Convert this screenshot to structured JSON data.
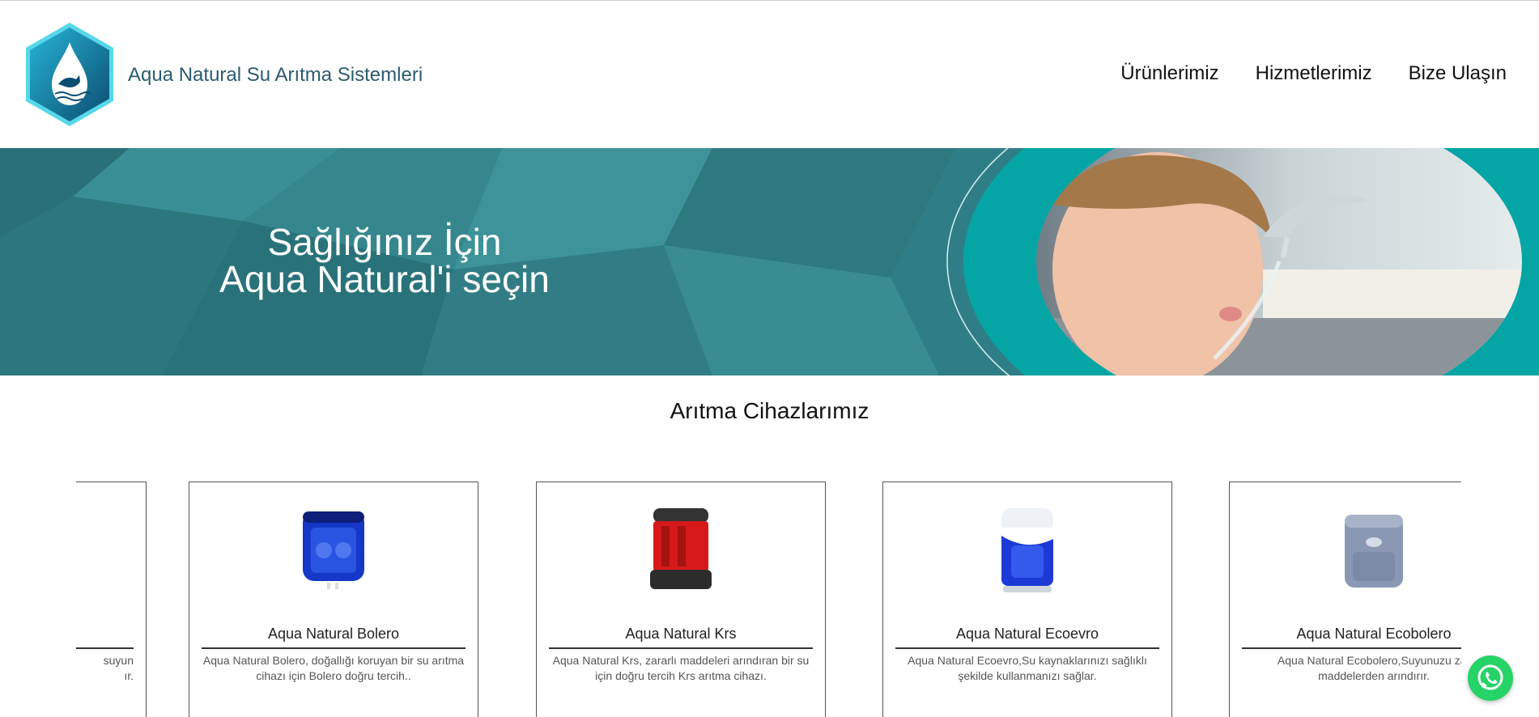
{
  "header": {
    "brand": "Aqua Natural Su Arıtma Sistemleri",
    "nav": [
      "Ürünlerimiz",
      "Hizmetlerimiz",
      "Bize Ulaşın"
    ]
  },
  "hero": {
    "line1": "Sağlığınız İçin",
    "line2": "Aqua Natural'i seçin"
  },
  "section": {
    "title": "Arıtma Cihazlarımız"
  },
  "products": [
    {
      "name": "",
      "desc_line1": "suyun",
      "desc_line2": "ır."
    },
    {
      "name": "Aqua Natural Bolero",
      "desc_line1": "Aqua Natural Bolero, doğallığı koruyan bir su arıtma",
      "desc_line2": "cihazı için Bolero doğru tercih.."
    },
    {
      "name": "Aqua Natural Krs",
      "desc_line1": "Aqua Natural Krs, zararlı maddeleri arındıran bir su",
      "desc_line2": "için doğru tercih Krs arıtma cihazı."
    },
    {
      "name": "Aqua Natural Ecoevro",
      "desc_line1": "Aqua Natural Ecoevro,Su kaynaklarınızı sağlıklı",
      "desc_line2": "şekilde kullanmanızı sağlar."
    },
    {
      "name": "Aqua Natural Ecobolero",
      "desc_line1": "Aqua Natural Ecobolero,Suyunuzu zar",
      "desc_line2": "maddelerden arındırır."
    }
  ],
  "colors": {
    "teal": "#2f7e87",
    "accent": "#06a5a5",
    "brand_text": "#2b5c6e",
    "whatsapp": "#25d366"
  },
  "icons": {
    "logo": "dolphin-drop-logo-icon",
    "whatsapp": "whatsapp-icon"
  }
}
